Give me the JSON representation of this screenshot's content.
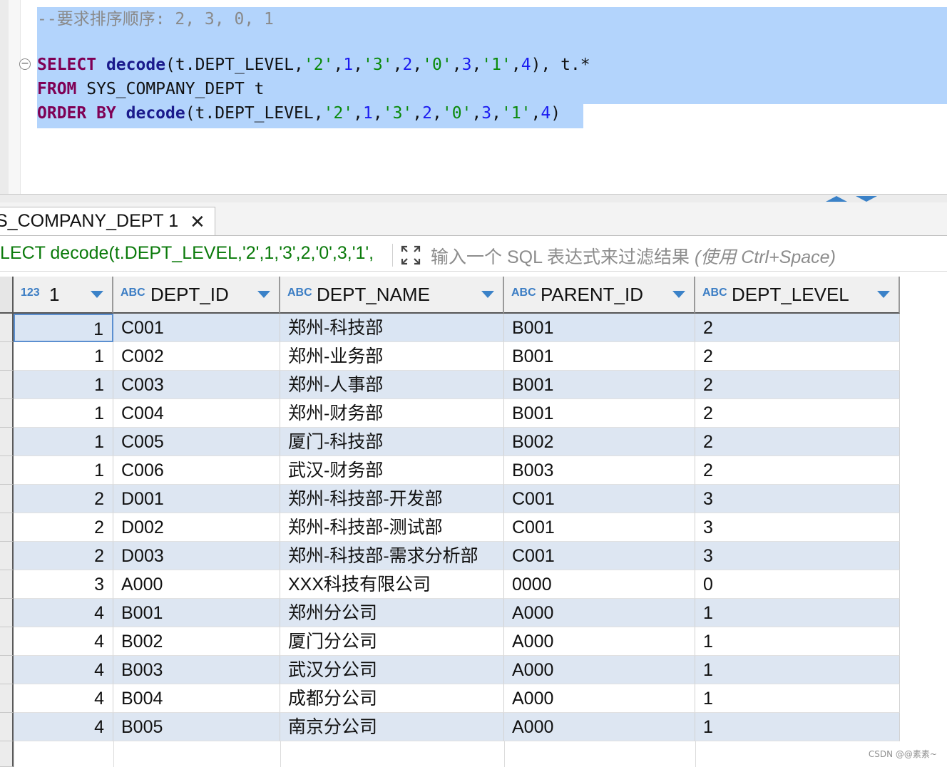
{
  "editor": {
    "comment": "--要求排序顺序: 2, 3, 0, 1",
    "fold_icon": "minus-circle-icon",
    "line1": {
      "kw": "SELECT",
      "fn": "decode",
      "open": "(t.DEPT_LEVEL,",
      "s1": "'2'",
      "c1": ",",
      "n1": "1",
      "c2": ",",
      "s2": "'3'",
      "c3": ",",
      "n2": "2",
      "c4": ",",
      "s3": "'0'",
      "c5": ",",
      "n3": "3",
      "c6": ",",
      "s4": "'1'",
      "c7": ",",
      "n4": "4",
      "tail": "), t.*"
    },
    "line2": {
      "kw": "FROM",
      "rest": " SYS_COMPANY_DEPT t"
    },
    "line3": {
      "kw": "ORDER BY",
      "fn": "decode",
      "open": "(t.DEPT_LEVEL,",
      "s1": "'2'",
      "c1": ",",
      "n1": "1",
      "c2": ",",
      "s2": "'3'",
      "c3": ",",
      "n2": "2",
      "c4": ",",
      "s3": "'0'",
      "c5": ",",
      "n3": "3",
      "c6": ",",
      "s4": "'1'",
      "c7": ",",
      "n4": "4",
      "tail": ")"
    }
  },
  "splitter": {
    "up_icon": "collapse-up-icon",
    "down_icon": "expand-down-icon"
  },
  "result_tab": {
    "label": "S_COMPANY_DEPT 1",
    "close": "✕"
  },
  "filter": {
    "query": "LECT decode(t.DEPT_LEVEL,'2',1,'3',2,'0',3,'1',",
    "expand_icon": "expand-icon",
    "placeholder_main": "输入一个 SQL 表达式来过滤结果 ",
    "placeholder_hint": "(使用 Ctrl+Space)"
  },
  "grid": {
    "columns": [
      {
        "type": "123",
        "name": "1"
      },
      {
        "type": "ABC",
        "name": "DEPT_ID"
      },
      {
        "type": "ABC",
        "name": "DEPT_NAME"
      },
      {
        "type": "ABC",
        "name": "PARENT_ID"
      },
      {
        "type": "ABC",
        "name": "DEPT_LEVEL"
      }
    ],
    "rows": [
      [
        "1",
        "C001",
        "郑州-科技部",
        "B001",
        "2"
      ],
      [
        "1",
        "C002",
        "郑州-业务部",
        "B001",
        "2"
      ],
      [
        "1",
        "C003",
        "郑州-人事部",
        "B001",
        "2"
      ],
      [
        "1",
        "C004",
        "郑州-财务部",
        "B001",
        "2"
      ],
      [
        "1",
        "C005",
        "厦门-科技部",
        "B002",
        "2"
      ],
      [
        "1",
        "C006",
        "武汉-财务部",
        "B003",
        "2"
      ],
      [
        "2",
        "D001",
        "郑州-科技部-开发部",
        "C001",
        "3"
      ],
      [
        "2",
        "D002",
        "郑州-科技部-测试部",
        "C001",
        "3"
      ],
      [
        "2",
        "D003",
        "郑州-科技部-需求分析部",
        "C001",
        "3"
      ],
      [
        "3",
        "A000",
        "XXX科技有限公司",
        "0000",
        "0"
      ],
      [
        "4",
        "B001",
        "郑州分公司",
        "A000",
        "1"
      ],
      [
        "4",
        "B002",
        "厦门分公司",
        "A000",
        "1"
      ],
      [
        "4",
        "B003",
        "武汉分公司",
        "A000",
        "1"
      ],
      [
        "4",
        "B004",
        "成都分公司",
        "A000",
        "1"
      ],
      [
        "4",
        "B005",
        "南京分公司",
        "A000",
        "1"
      ]
    ]
  },
  "watermark": "CSDN @@素素~"
}
